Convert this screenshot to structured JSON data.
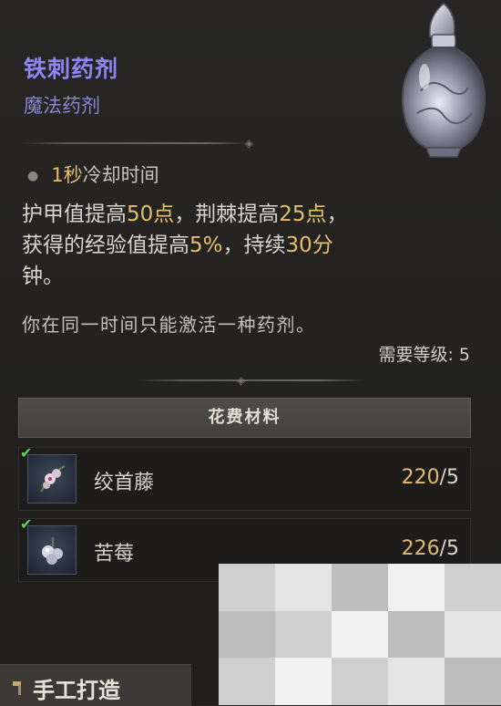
{
  "item": {
    "title": "铁刺药剂",
    "type": "魔法药剂",
    "icon": "potion-bottle-icon"
  },
  "stats": {
    "cooldown_value": "1秒",
    "cooldown_label": "冷却时间"
  },
  "description": {
    "armor_prefix": "护甲值提高",
    "armor_value": "50点",
    "thorns_prefix": "，荆棘提高",
    "thorns_value": "25点",
    "thorns_suffix": "，",
    "xp_prefix": "获得的经验值提高",
    "xp_value": "5%",
    "duration_prefix": "，持续",
    "duration_value": "30分",
    "duration_suffix": "钟。",
    "note": "你在同一时间只能激活一种药剂。"
  },
  "requirement": "需要等级: 5",
  "materials": {
    "header": "花费材料",
    "items": [
      {
        "name": "绞首藤",
        "have": "220",
        "need": "/5",
        "icon": "plant-icon",
        "met": true
      },
      {
        "name": "苦莓",
        "have": "226",
        "need": "/5",
        "icon": "berry-icon",
        "met": true
      }
    ]
  },
  "footer": {
    "craft_label": "手工打造",
    "icon": "hammer-icon"
  }
}
